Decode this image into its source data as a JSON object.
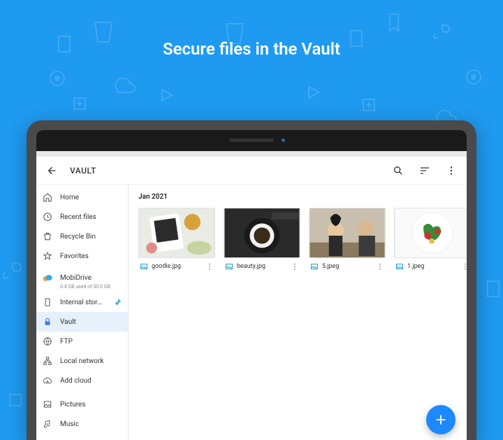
{
  "headline": "Secure files in the Vault",
  "appbar": {
    "title": "VAULT"
  },
  "sidebar": {
    "home": "Home",
    "recent": "Recent files",
    "recycle": "Recycle Bin",
    "favorites": "Favorites",
    "mobidrive": {
      "label": "MobiDrive",
      "sub": "0.4 GB used of 50.0 GB"
    },
    "internal": "Internal stora...",
    "vault": "Vault",
    "ftp": "FTP",
    "lan": "Local network",
    "addcloud": "Add cloud",
    "pictures": "Pictures",
    "music": "Music"
  },
  "content": {
    "section_title": "Jan 2021",
    "files": [
      {
        "name": "goodie.jpg"
      },
      {
        "name": "beauty.jpg"
      },
      {
        "name": "5.jpeg"
      },
      {
        "name": "1.jpeg"
      }
    ]
  },
  "colors": {
    "accent": "#1e88ff",
    "bg": "#1e9af0"
  }
}
